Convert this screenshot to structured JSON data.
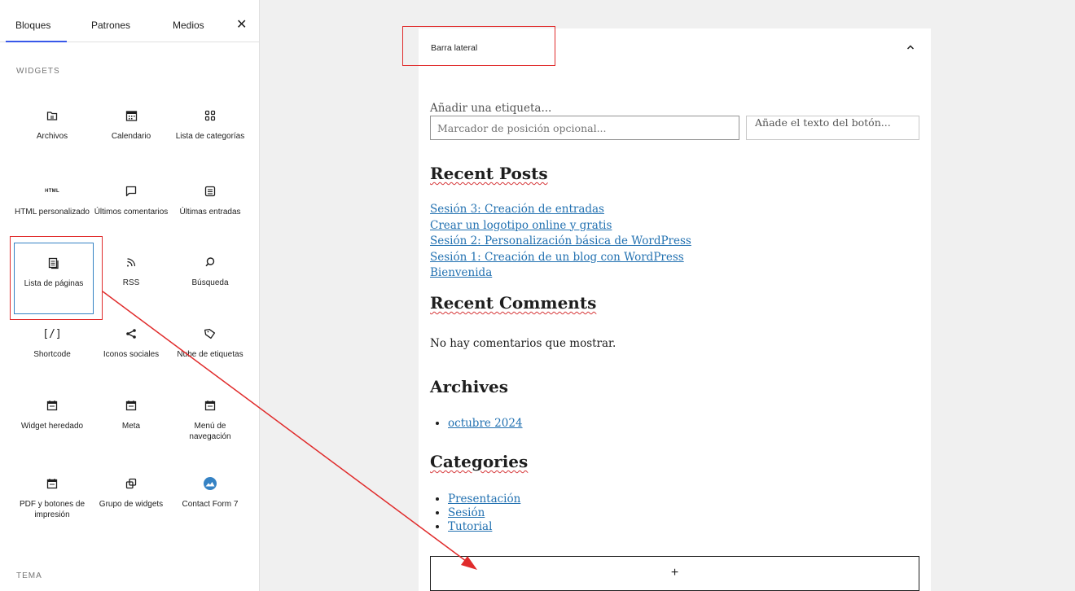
{
  "inserter": {
    "tabs": [
      {
        "label": "Bloques",
        "active": true
      },
      {
        "label": "Patrones",
        "active": false
      },
      {
        "label": "Medios",
        "active": false
      }
    ],
    "close_symbol": "✕",
    "sections": [
      {
        "title": "WIDGETS"
      },
      {
        "title": "TEMA"
      }
    ],
    "blocks": [
      {
        "icon": "archive-folder-icon",
        "label": "Archivos"
      },
      {
        "icon": "calendar-icon",
        "label": "Calendario"
      },
      {
        "icon": "category-grid-icon",
        "label": "Lista de categorías"
      },
      {
        "icon": "html-icon",
        "icon_text": "HTML",
        "label": "HTML personalizado"
      },
      {
        "icon": "comment-bubble-icon",
        "label": "Últimos comentarios"
      },
      {
        "icon": "post-list-icon",
        "label": "Últimas entradas"
      },
      {
        "icon": "page-list-icon",
        "label": "Lista de páginas",
        "selected": true
      },
      {
        "icon": "rss-icon",
        "label": "RSS"
      },
      {
        "icon": "search-icon",
        "label": "Búsqueda"
      },
      {
        "icon": "shortcode-icon",
        "icon_text": "[/]",
        "label": "Shortcode"
      },
      {
        "icon": "share-icon",
        "label": "Iconos sociales"
      },
      {
        "icon": "tag-icon",
        "label": "Nube de etiquetas"
      },
      {
        "icon": "widget-legacy-icon",
        "label": "Widget heredado"
      },
      {
        "icon": "widget-meta-icon",
        "label": "Meta"
      },
      {
        "icon": "navigation-menu-icon",
        "label": "Menú de navegación"
      },
      {
        "icon": "pdf-print-icon",
        "label": "PDF y botones de impresión"
      },
      {
        "icon": "widget-group-icon",
        "label": "Grupo de widgets"
      },
      {
        "icon": "contact-form-7-icon",
        "label": "Contact Form 7"
      }
    ]
  },
  "editor": {
    "widget_area_title": "Barra lateral",
    "search": {
      "label": "Añadir una etiqueta...",
      "placeholder": "Marcador de posición opcional...",
      "button_label": "Añade el texto del botón..."
    },
    "recent_posts": {
      "title": "Recent Posts",
      "items": [
        "Sesión 3: Creación de entradas",
        "Crear un logotipo online y gratis",
        "Sesión 2: Personalización básica de WordPress",
        "Sesión 1: Creación de un blog con WordPress",
        "Bienvenida"
      ]
    },
    "recent_comments": {
      "title": "Recent Comments",
      "empty_text": "No hay comentarios que mostrar."
    },
    "archives": {
      "title": "Archives",
      "items": [
        "octubre 2024"
      ]
    },
    "categories": {
      "title": "Categories",
      "items": [
        "Presentación",
        "Sesión",
        "Tutorial"
      ]
    },
    "add_block_symbol": "+"
  },
  "colors": {
    "annotation_red": "#e02b2b",
    "link_blue": "#2271b1",
    "selection_blue": "#3582c4",
    "tab_accent": "#3858e9"
  }
}
